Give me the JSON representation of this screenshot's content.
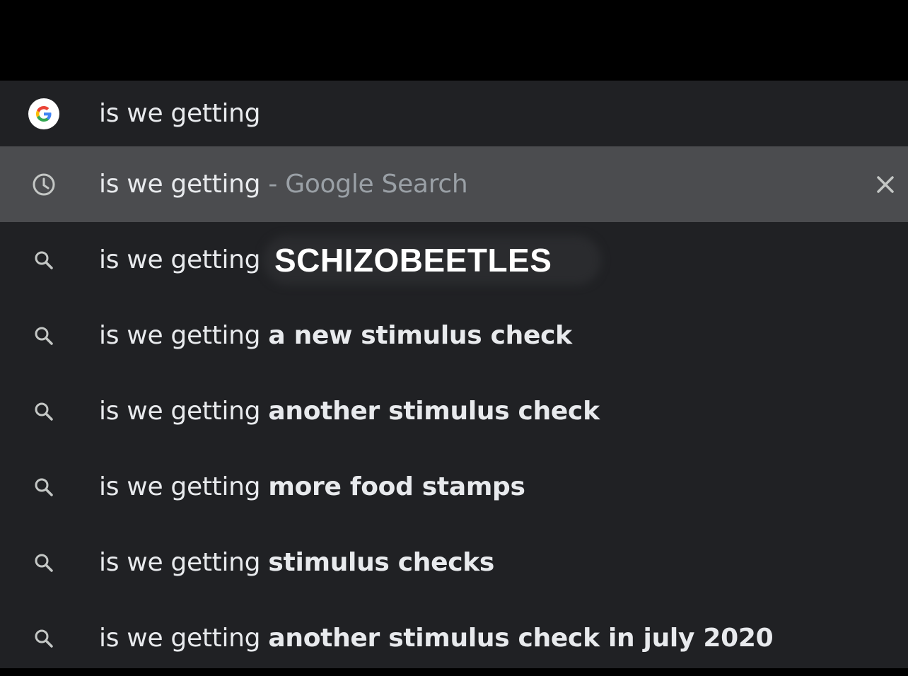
{
  "omnibox": {
    "query": "is we getting",
    "icon": "google-g-icon"
  },
  "suggestions": [
    {
      "icon": "history-clock-icon",
      "prefix": "is we getting",
      "separator": " - ",
      "suffix": "Google Search",
      "selected": true,
      "remove_label": "✕"
    },
    {
      "icon": "search-icon",
      "prefix": "is we getting",
      "suffix": "",
      "overlay_text": "SCHIZOBEETLES"
    },
    {
      "icon": "search-icon",
      "prefix": "is we getting",
      "suffix": "a new stimulus check"
    },
    {
      "icon": "search-icon",
      "prefix": "is we getting",
      "suffix": "another stimulus check"
    },
    {
      "icon": "search-icon",
      "prefix": "is we getting",
      "suffix": "more food stamps"
    },
    {
      "icon": "search-icon",
      "prefix": "is we getting",
      "suffix": "stimulus checks"
    },
    {
      "icon": "search-icon",
      "prefix": "is we getting",
      "suffix": "another stimulus check in july 2020"
    }
  ],
  "colors": {
    "background": "#202124",
    "selected_row": "#4b4c4f",
    "text": "#e8eaed",
    "muted_text": "#9aa0a6"
  }
}
